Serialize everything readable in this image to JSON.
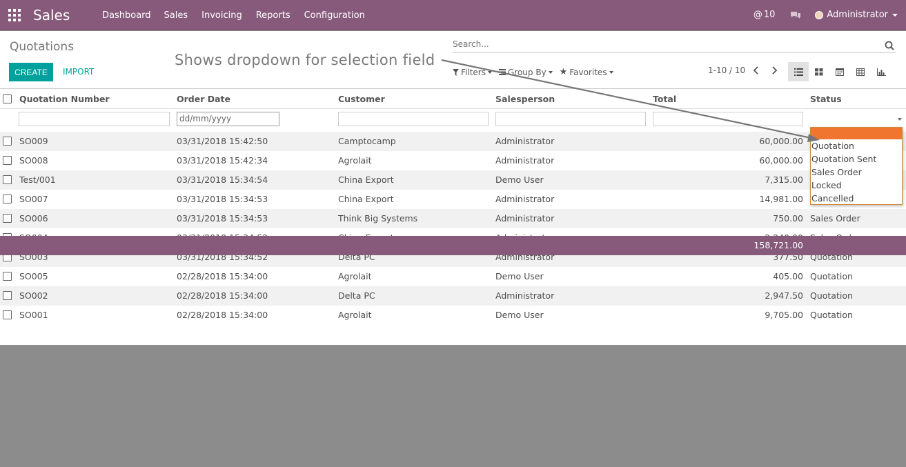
{
  "app": {
    "title": "Sales",
    "menu": [
      "Dashboard",
      "Sales",
      "Invoicing",
      "Reports",
      "Configuration"
    ],
    "mentions_count": "10",
    "user": "Administrator",
    "brand_color": "#875a7b",
    "accent_color": "#00a09d"
  },
  "control_panel": {
    "breadcrumb": "Quotations",
    "create_label": "CREATE",
    "import_label": "IMPORT",
    "search_placeholder": "Search...",
    "filters_label": "Filters",
    "groupby_label": "Group By",
    "favorites_label": "Favorites",
    "pager": "1-10 / 10",
    "views": [
      "list-icon",
      "kanban-icon",
      "calendar-icon",
      "pivot-icon",
      "graph-icon"
    ],
    "active_view": "list"
  },
  "annotation": {
    "text": "Shows dropdown for selection field"
  },
  "table": {
    "columns": [
      "Quotation Number",
      "Order Date",
      "Customer",
      "Salesperson",
      "Total",
      "Status"
    ],
    "date_filter_placeholder": "dd/mm/yyyy",
    "rows": [
      {
        "number": "SO009",
        "date": "03/31/2018 15:42:50",
        "customer": "Camptocamp",
        "salesperson": "Administrator",
        "total": "60,000.00",
        "status": ""
      },
      {
        "number": "SO008",
        "date": "03/31/2018 15:42:34",
        "customer": "Agrolait",
        "salesperson": "Administrator",
        "total": "60,000.00",
        "status": ""
      },
      {
        "number": "Test/001",
        "date": "03/31/2018 15:34:54",
        "customer": "China Export",
        "salesperson": "Demo User",
        "total": "7,315.00",
        "status": ""
      },
      {
        "number": "SO007",
        "date": "03/31/2018 15:34:53",
        "customer": "China Export",
        "salesperson": "Administrator",
        "total": "14,981.00",
        "status": ""
      },
      {
        "number": "SO006",
        "date": "03/31/2018 15:34:53",
        "customer": "Think Big Systems",
        "salesperson": "Administrator",
        "total": "750.00",
        "status": "Sales Order"
      },
      {
        "number": "SO004",
        "date": "03/31/2018 15:34:52",
        "customer": "China Export",
        "salesperson": "Administrator",
        "total": "2,240.00",
        "status": "Sales Order"
      },
      {
        "number": "SO003",
        "date": "03/31/2018 15:34:52",
        "customer": "Delta PC",
        "salesperson": "Administrator",
        "total": "377.50",
        "status": "Quotation"
      },
      {
        "number": "SO005",
        "date": "02/28/2018 15:34:00",
        "customer": "Agrolait",
        "salesperson": "Demo User",
        "total": "405.00",
        "status": "Quotation"
      },
      {
        "number": "SO002",
        "date": "02/28/2018 15:34:00",
        "customer": "Delta PC",
        "salesperson": "Administrator",
        "total": "2,947.50",
        "status": "Quotation"
      },
      {
        "number": "SO001",
        "date": "02/28/2018 15:34:00",
        "customer": "Agrolait",
        "salesperson": "Demo User",
        "total": "9,705.00",
        "status": "Quotation"
      }
    ],
    "grand_total": "158,721.00"
  },
  "status_dropdown": {
    "options": [
      "",
      "Quotation",
      "Quotation Sent",
      "Sales Order",
      "Locked",
      "Cancelled"
    ],
    "highlighted_index": 0,
    "highlight_color": "#f0762f"
  }
}
